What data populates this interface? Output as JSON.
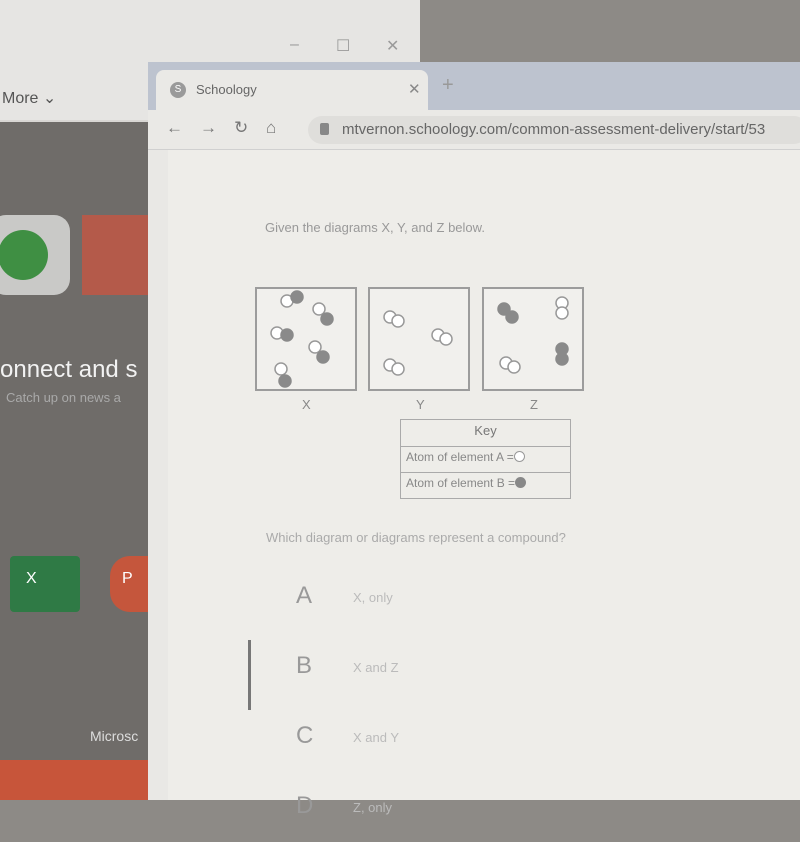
{
  "background_window": {
    "more_label": "More",
    "connect_text": "onnect and s",
    "catch_text": "Catch up on news a",
    "excel_icon_letter": "X",
    "ppt_icon_letter": "P",
    "taskbar_text": "Microsc"
  },
  "browser": {
    "tab_title": "Schoology",
    "favicon_letter": "S",
    "url": "mtvernon.schoology.com/common-assessment-delivery/start/53"
  },
  "question": {
    "prompt": "Given the diagrams X, Y, and Z below.",
    "diagrams": [
      {
        "label": "X",
        "molecules": [
          "AB",
          "AB",
          "AB",
          "AB",
          "AB"
        ]
      },
      {
        "label": "Y",
        "molecules": [
          "AA",
          "AA",
          "AA"
        ]
      },
      {
        "label": "Z",
        "molecules": [
          "BB",
          "AA",
          "BB",
          "AA"
        ]
      }
    ],
    "key": {
      "title": "Key",
      "row_a": "Atom of element A =",
      "row_b": "Atom of element B ="
    },
    "ask": "Which diagram or diagrams represent a compound?",
    "options": [
      {
        "letter": "A",
        "text": "X, only"
      },
      {
        "letter": "B",
        "text": "X and Z"
      },
      {
        "letter": "C",
        "text": "X and Y"
      },
      {
        "letter": "D",
        "text": "Z, only"
      }
    ],
    "selected": "C"
  }
}
